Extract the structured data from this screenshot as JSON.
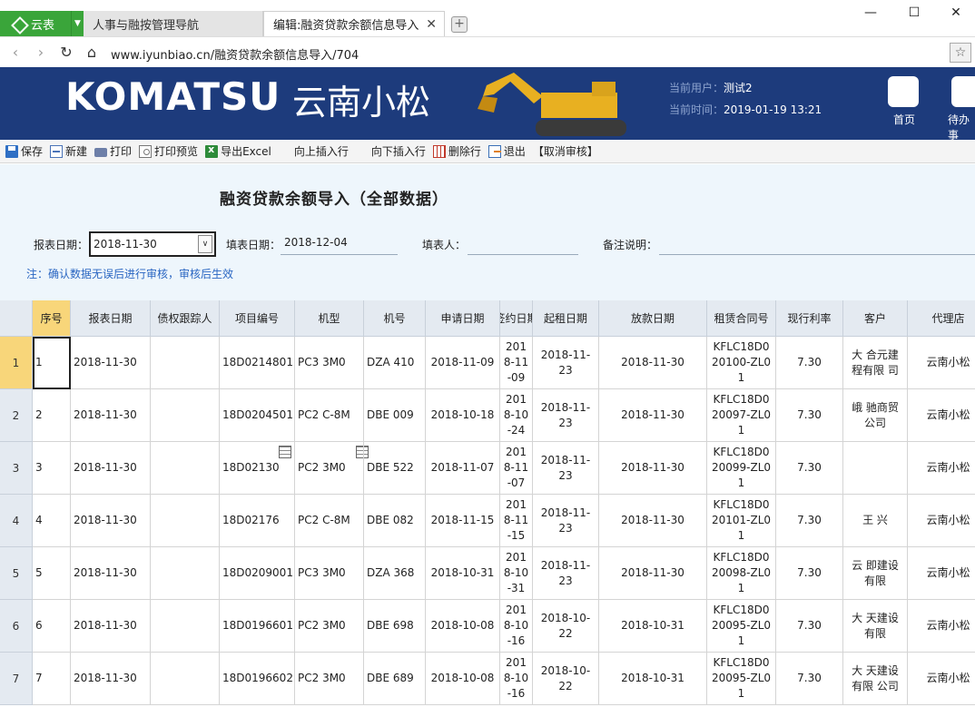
{
  "browser": {
    "brand_label": "云表",
    "tabs": [
      {
        "label": "人事与融按管理导航"
      },
      {
        "label": "编辑:融资贷款余额信息导入"
      }
    ],
    "url": "www.iyunbiao.cn/融资贷款余额信息导入/704",
    "window_controls": {
      "minimize": "—",
      "maximize": "☐",
      "close": "✕"
    }
  },
  "banner": {
    "logo_text": "KOMATSU",
    "brand_cn": "云南小松",
    "current_user_label": "当前用户：",
    "current_user": "测试2",
    "current_time_label": "当前时间：",
    "current_time": "2019-01-19 13:21",
    "nav": [
      {
        "label": "首页"
      },
      {
        "label": "待办事"
      }
    ]
  },
  "toolbar": [
    {
      "label": "保存",
      "icon": "save-icon"
    },
    {
      "label": "新建",
      "icon": "new-icon"
    },
    {
      "label": "打印",
      "icon": "print-icon"
    },
    {
      "label": "打印预览",
      "icon": "print-preview-icon"
    },
    {
      "label": "导出Excel",
      "icon": "excel-icon"
    },
    {
      "label": "向上插入行",
      "icon": "insert-above-icon"
    },
    {
      "label": "向下插入行",
      "icon": "insert-below-icon"
    },
    {
      "label": "删除行",
      "icon": "delete-row-icon"
    },
    {
      "label": "退出",
      "icon": "exit-icon"
    },
    {
      "label": "【取消审核】",
      "icon": ""
    }
  ],
  "form": {
    "title": "融资贷款余额导入（全部数据）",
    "report_date_label": "报表日期：",
    "report_date": "2018-11-30",
    "fill_date_label": "填表日期：",
    "fill_date": "2018-12-04",
    "filler_label": "填表人：",
    "filler": "",
    "remark_label": "备注说明：",
    "remark": "",
    "note": "注：确认数据无误后进行审核，审核后生效"
  },
  "grid": {
    "columns": [
      "序号",
      "报表日期",
      "债权跟踪人",
      "项目编号",
      "机型",
      "机号",
      "申请日期",
      "签约日期",
      "起租日期",
      "放款日期",
      "租赁合同号",
      "现行利率",
      "客户",
      "代理店"
    ],
    "rows": [
      {
        "n": "1",
        "seq": "1",
        "report_date": "2018-11-30",
        "tracker": "",
        "project": "18D0214801",
        "model": "PC3  3M0",
        "serial": "DZA  410",
        "apply": "2018-11-09",
        "sign": "2018-11-09",
        "start": "2018-11-23",
        "loan": "2018-11-30",
        "contract": "KFLC18D020100-ZL01",
        "rate": "7.30",
        "customer": "大  合元建  程有限  司",
        "dealer": "云南小松"
      },
      {
        "n": "2",
        "seq": "2",
        "report_date": "2018-11-30",
        "tracker": "",
        "project": "18D0204501",
        "model": "PC2  C-8M",
        "serial": "DBE  009",
        "apply": "2018-10-18",
        "sign": "2018-10-24",
        "start": "2018-11-23",
        "loan": "2018-11-30",
        "contract": "KFLC18D020097-ZL01",
        "rate": "7.30",
        "customer": "峨  驰商贸  公司",
        "dealer": "云南小松"
      },
      {
        "n": "3",
        "seq": "3",
        "report_date": "2018-11-30",
        "tracker": "",
        "project": "18D02130",
        "model": "PC2  3M0",
        "serial": "DBE  522",
        "apply": "2018-11-07",
        "sign": "2018-11-07",
        "start": "2018-11-23",
        "loan": "2018-11-30",
        "contract": "KFLC18D020099-ZL01",
        "rate": "7.30",
        "customer": "",
        "dealer": "云南小松"
      },
      {
        "n": "4",
        "seq": "4",
        "report_date": "2018-11-30",
        "tracker": "",
        "project": "18D02176",
        "model": "PC2  C-8M",
        "serial": "DBE  082",
        "apply": "2018-11-15",
        "sign": "2018-11-15",
        "start": "2018-11-23",
        "loan": "2018-11-30",
        "contract": "KFLC18D020101-ZL01",
        "rate": "7.30",
        "customer": "王  兴",
        "dealer": "云南小松"
      },
      {
        "n": "5",
        "seq": "5",
        "report_date": "2018-11-30",
        "tracker": "",
        "project": "18D0209001",
        "model": "PC3  3M0",
        "serial": "DZA  368",
        "apply": "2018-10-31",
        "sign": "2018-10-31",
        "start": "2018-11-23",
        "loan": "2018-11-30",
        "contract": "KFLC18D020098-ZL01",
        "rate": "7.30",
        "customer": "云  即建设  有限",
        "dealer": "云南小松"
      },
      {
        "n": "6",
        "seq": "6",
        "report_date": "2018-11-30",
        "tracker": "",
        "project": "18D0196601",
        "model": "PC2  3M0",
        "serial": "DBE  698",
        "apply": "2018-10-08",
        "sign": "2018-10-16",
        "start": "2018-10-22",
        "loan": "2018-10-31",
        "contract": "KFLC18D020095-ZL01",
        "rate": "7.30",
        "customer": "大  天建设  有限",
        "dealer": "云南小松"
      },
      {
        "n": "7",
        "seq": "7",
        "report_date": "2018-11-30",
        "tracker": "",
        "project": "18D0196602",
        "model": "PC2  3M0",
        "serial": "DBE  689",
        "apply": "2018-10-08",
        "sign": "2018-10-16",
        "start": "2018-10-22",
        "loan": "2018-10-31",
        "contract": "KFLC18D020095-ZL01",
        "rate": "7.30",
        "customer": "大  天建设  有限  公司",
        "dealer": "云南小松"
      }
    ]
  }
}
